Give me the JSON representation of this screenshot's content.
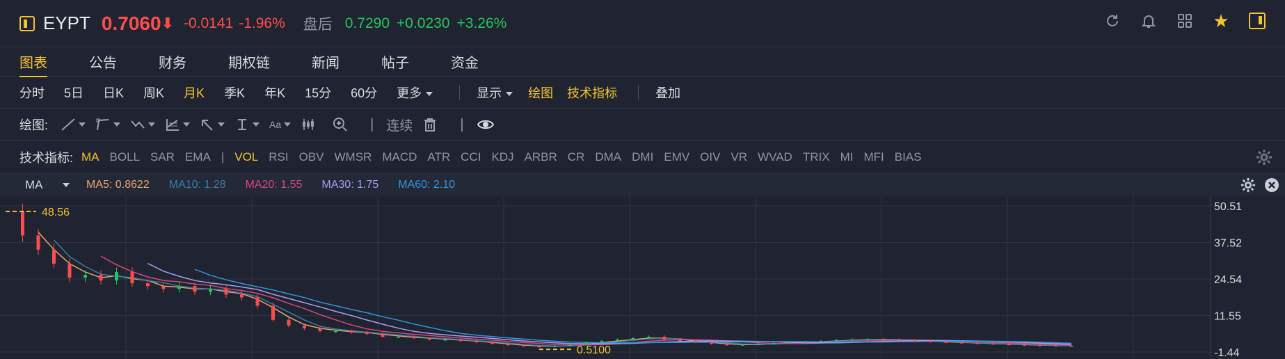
{
  "header": {
    "ticker": "EYPT",
    "price": "0.7060",
    "price_arrow": "⬇",
    "change": "-0.0141",
    "change_pct": "-1.96%",
    "after_hours_label": "盘后",
    "after_price": "0.7290",
    "after_change": "+0.0230",
    "after_change_pct": "+3.26%"
  },
  "tabs": [
    "图表",
    "公告",
    "财务",
    "期权链",
    "新闻",
    "帖子",
    "资金"
  ],
  "periods": [
    "分时",
    "5日",
    "日K",
    "周K",
    "月K",
    "季K",
    "年K",
    "15分",
    "60分"
  ],
  "period_more": "更多",
  "view": {
    "display": "显示",
    "draw": "绘图",
    "tech": "技术指标",
    "overlay": "叠加"
  },
  "draw_bar": {
    "label": "绘图:",
    "text_size": "Aa",
    "continuous": "连续",
    "bar": "|"
  },
  "indicators_label": "技术指标:",
  "overlay_indicators": [
    "MA",
    "BOLL",
    "SAR",
    "EMA"
  ],
  "sub_indicators": [
    "VOL",
    "RSI",
    "OBV",
    "WMSR",
    "MACD",
    "ATR",
    "CCI",
    "KDJ",
    "ARBR",
    "CR",
    "DMA",
    "DMI",
    "EMV",
    "OIV",
    "VR",
    "WVAD",
    "TRIX",
    "MI",
    "MFI",
    "BIAS"
  ],
  "indicator_sep": "|",
  "ma_legend": {
    "selected": "MA",
    "items": [
      {
        "label": "MA5: 0.8622",
        "color": "#e8a56b"
      },
      {
        "label": "MA10: 1.28",
        "color": "#3a7ca5"
      },
      {
        "label": "MA20: 1.55",
        "color": "#d6467e"
      },
      {
        "label": "MA30: 1.75",
        "color": "#a99cf0"
      },
      {
        "label": "MA60: 2.10",
        "color": "#2f95e0"
      }
    ]
  },
  "chart_data": {
    "type": "line",
    "y_ticks": [
      "50.51",
      "37.52",
      "24.54",
      "11.55",
      "-1.44"
    ],
    "ylim": [
      -1.44,
      50.51
    ],
    "high_marker": "48.56",
    "low_marker": "0.5100",
    "colors": {
      "up": "#23c45e",
      "down": "#ff4d4f",
      "marker": "#f2c230"
    },
    "price_path": [
      48.56,
      40,
      35,
      30,
      25,
      26,
      24,
      27,
      23,
      22,
      21,
      22,
      20,
      21,
      19,
      18,
      15,
      10,
      8,
      7,
      6,
      6,
      5.5,
      5,
      4,
      4,
      3.5,
      3,
      3,
      2.5,
      2,
      1.5,
      1,
      0.6,
      0.51,
      0.7,
      1.2,
      2,
      2.5,
      3,
      3.5,
      4,
      3,
      2.5,
      2,
      1.5,
      1,
      1.2,
      1.5,
      1.8,
      2,
      2.2,
      2.5,
      2.8,
      3,
      3.2,
      3,
      2.8,
      2.5,
      2.2,
      2,
      1.8,
      1.6,
      1.4,
      1.2,
      1.0,
      0.9,
      0.8,
      0.71
    ]
  },
  "colors": {
    "accent": "#f2c230",
    "up": "#23c45e",
    "down": "#ff4d4f",
    "bg": "#1f2430"
  }
}
